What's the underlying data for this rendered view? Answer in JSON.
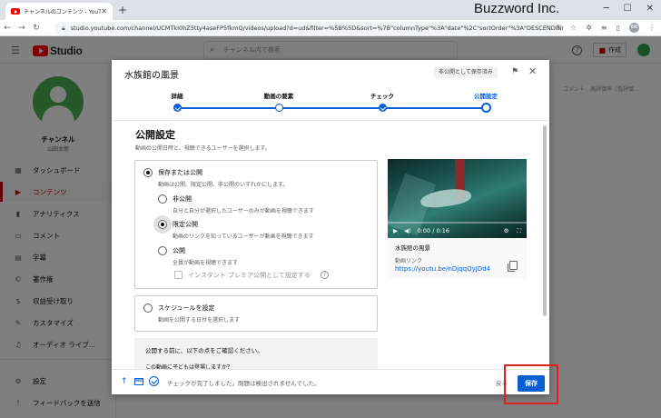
{
  "browser": {
    "tab_title": "チャンネルのコンテンツ - YouTube St",
    "new_tab": "+",
    "brand": "Buzzword Inc.",
    "url": "studio.youtube.com/channel/UCMTkI0hZ5tty4aseFP5fkmQ/videos/upload?d=ud&filter=%5B%5D&sort=%7B\"columnType\"%3A\"date\"%2C\"sortOrder\"%3A\"DESCENDING\"%...",
    "avatar_initials": "BW"
  },
  "studio": {
    "logo_text": "Studio",
    "search_placeholder": "チャンネル内で検索",
    "create_label": "作成",
    "channel_name": "チャンネル",
    "channel_sub": "山田太郎",
    "nav": [
      {
        "label": "ダッシュボード",
        "icon": "dashboard-icon"
      },
      {
        "label": "コンテンツ",
        "icon": "content-icon"
      },
      {
        "label": "アナリティクス",
        "icon": "analytics-icon"
      },
      {
        "label": "コメント",
        "icon": "comments-icon"
      },
      {
        "label": "字幕",
        "icon": "subtitles-icon"
      },
      {
        "label": "著作権",
        "icon": "copyright-icon"
      },
      {
        "label": "収益受け取り",
        "icon": "monetization-icon"
      },
      {
        "label": "カスタマイズ",
        "icon": "customize-icon"
      },
      {
        "label": "オーディオ ライブ...",
        "icon": "audio-library-icon"
      },
      {
        "label": "設定",
        "icon": "settings-icon"
      },
      {
        "label": "フィードバックを送信",
        "icon": "feedback-icon"
      }
    ],
    "bg_columns": "コメント　高評価率（低評価..."
  },
  "dialog": {
    "title": "水族館の風景",
    "badge": "非公開として保存済み",
    "steps": [
      "詳細",
      "動画の要素",
      "チェック",
      "公開設定"
    ],
    "section_title": "公開設定",
    "section_desc": "動画の公開日時と、視聴できるユーザーを選択します。",
    "visibility": {
      "label": "保存または公開",
      "desc": "動画は公開、限定公開、非公開のいずれかにします。",
      "options": [
        {
          "label": "非公開",
          "desc": "自分と自分が選択したユーザーのみが動画を視聴できます"
        },
        {
          "label": "限定公開",
          "desc": "動画のリンクを知っているユーザーが動画を視聴できます"
        },
        {
          "label": "公開",
          "desc": "全員が動画を視聴できます"
        }
      ],
      "selected": "限定公開",
      "premiere_label": "インスタント プレミア公開として設定する"
    },
    "schedule": {
      "label": "スケジュールを設定",
      "desc": "動画を公開する日付を選択します"
    },
    "precheck": {
      "title": "公開する前に、以下の点をご確認ください。",
      "question": "この動画に子どもは登場しますか？"
    },
    "video": {
      "time": "0:00 / 0:16",
      "title": "水族館の風景",
      "link_label": "動画リンク",
      "link": "https://youtu.be/nDjqqQyJDd4"
    },
    "footer": {
      "hd_label": "HD",
      "status": "チェックが完了しました。問題は検出されませんでした。",
      "back_label": "戻る",
      "save_label": "保存"
    }
  },
  "colors": {
    "accent": "#065fd4",
    "yt_red": "#ff0000",
    "highlight": "#e0201c"
  }
}
